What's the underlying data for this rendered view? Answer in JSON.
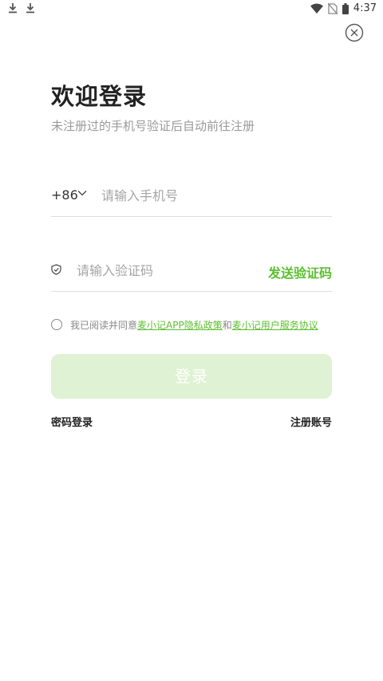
{
  "status_bar": {
    "time": "4:37",
    "left_icons": [
      "download-icon",
      "download-icon"
    ],
    "right_icons": [
      "wifi-icon",
      "no-sim-icon",
      "battery-icon"
    ]
  },
  "header": {
    "close_icon": "close-circle-icon",
    "title": "欢迎登录",
    "subtitle": "未注册过的手机号验证后自动前往注册"
  },
  "phone": {
    "country_code": "+86",
    "placeholder": "请输入手机号",
    "value": ""
  },
  "code": {
    "icon": "shield-icon",
    "placeholder": "请输入验证码",
    "value": "",
    "send_label": "发送验证码"
  },
  "agreement": {
    "checked": false,
    "prefix": "我已阅读并同意",
    "privacy_link": "麦小记APP隐私政策",
    "and": "和",
    "service_link": "麦小记用户服务协议"
  },
  "login_button": "登录",
  "footer": {
    "password_login": "密码登录",
    "register": "注册账号"
  },
  "colors": {
    "accent": "#5cbf2e",
    "button_disabled_bg": "#dff2d4"
  }
}
